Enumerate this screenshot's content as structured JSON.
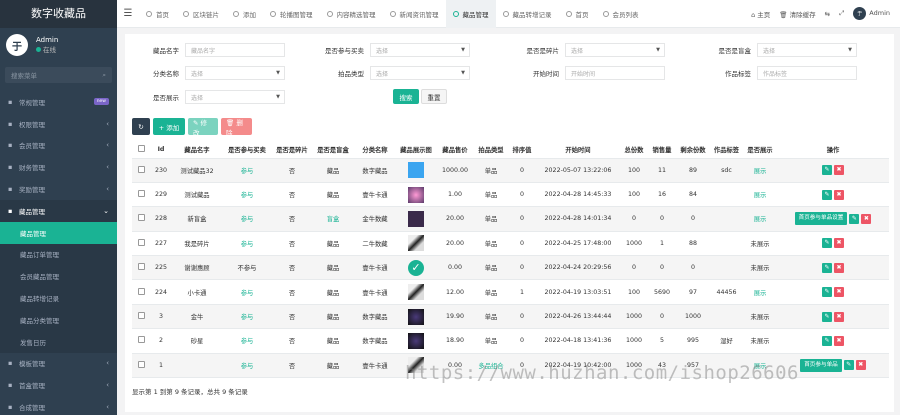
{
  "app": {
    "title": "数字收藏品"
  },
  "user": {
    "name": "Admin",
    "status": "在线",
    "avatar_text": "于哥"
  },
  "search": {
    "placeholder": "搜索菜单"
  },
  "sidebar": {
    "items": [
      {
        "label": "常规管理",
        "icon": "gear-icon",
        "badge": "new"
      },
      {
        "label": "权限管理",
        "icon": "lock-icon"
      },
      {
        "label": "会员管理",
        "icon": "user-icon"
      },
      {
        "label": "财务管理",
        "icon": "money-icon"
      },
      {
        "label": "奖励管理",
        "icon": "gift-icon"
      },
      {
        "label": "藏品管理",
        "icon": "box-icon",
        "open": true
      }
    ],
    "sub_items": [
      {
        "label": "藏品管理",
        "active": true
      },
      {
        "label": "藏品订单管理"
      },
      {
        "label": "会员藏品管理"
      },
      {
        "label": "藏品转增记录"
      },
      {
        "label": "藏品分类管理"
      },
      {
        "label": "发售日历"
      }
    ],
    "bottom_items": [
      {
        "label": "模板管理",
        "icon": "template-icon"
      },
      {
        "label": "首盒管理",
        "icon": "cube-icon"
      },
      {
        "label": "合成管理",
        "icon": "merge-icon"
      }
    ]
  },
  "topbar": {
    "tabs": [
      {
        "label": "首页"
      },
      {
        "label": "区块链片"
      },
      {
        "label": "添加"
      },
      {
        "label": "轮播图管理"
      },
      {
        "label": "内容精选管理"
      },
      {
        "label": "新闻资讯管理"
      },
      {
        "label": "藏品管理",
        "active": true
      },
      {
        "label": "藏品转增记录"
      },
      {
        "label": "首页"
      },
      {
        "label": "会员列表"
      }
    ],
    "right": {
      "home": "主页",
      "clear": "清除缓存",
      "admin": "Admin"
    }
  },
  "filters": {
    "rows": [
      [
        {
          "label": "藏品名字",
          "placeholder": "藏品名字",
          "type": "input"
        },
        {
          "label": "是否参与买卖",
          "placeholder": "选择",
          "type": "select"
        },
        {
          "label": "是否是碎片",
          "placeholder": "选择",
          "type": "select"
        },
        {
          "label": "是否是盲盒",
          "placeholder": "选择",
          "type": "select"
        }
      ],
      [
        {
          "label": "分类名称",
          "placeholder": "选择",
          "type": "select"
        },
        {
          "label": "拍品类型",
          "placeholder": "选择",
          "type": "select"
        },
        {
          "label": "开始时间",
          "placeholder": "开始时间",
          "type": "input"
        },
        {
          "label": "作品标签",
          "placeholder": "作品标签",
          "type": "input"
        }
      ],
      [
        {
          "label": "是否展示",
          "placeholder": "选择",
          "type": "select"
        }
      ]
    ],
    "search_label": "搜索",
    "reset_label": "重置"
  },
  "toolbar": {
    "add_label": "+ 添加",
    "edit_label": "✎ 修改",
    "delete_label": "🗑 删除"
  },
  "table": {
    "headers": [
      "",
      "Id",
      "藏品名字",
      "是否参与买卖",
      "是否是碎片",
      "是否是盲盒",
      "分类名称",
      "藏品展示图",
      "藏品售价",
      "拍品类型",
      "排序值",
      "开始时间",
      "总份数",
      "销售量",
      "剩余份数",
      "作品标签",
      "是否展示",
      "操作"
    ],
    "rows": [
      {
        "id": "230",
        "name": "测试藏品32",
        "trade": "参与",
        "frag": "否",
        "blind": "藏品",
        "cat": "数字藏品",
        "thumb": "blue",
        "price": "1000.00",
        "type": "单品",
        "sort": "0",
        "start": "2022-05-07 13:22:06",
        "total": "100",
        "sold": "11",
        "left": "89",
        "tag": "sdc",
        "show": "展示",
        "wide": ""
      },
      {
        "id": "229",
        "name": "测试藏品",
        "trade": "参与",
        "frag": "否",
        "blind": "藏品",
        "cat": "壹牛卡通",
        "thumb": "pink",
        "price": "1.00",
        "type": "单品",
        "sort": "0",
        "start": "2022-04-28 14:45:33",
        "total": "100",
        "sold": "16",
        "left": "84",
        "tag": "",
        "show": "展示",
        "wide": ""
      },
      {
        "id": "228",
        "name": "新盲盒",
        "trade": "参与",
        "frag": "否",
        "blind": "盲盒",
        "cat": "金牛数藏",
        "thumb": "dark",
        "price": "20.00",
        "type": "单品",
        "sort": "0",
        "start": "2022-04-28 14:01:34",
        "total": "0",
        "sold": "0",
        "left": "0",
        "tag": "",
        "show": "展示",
        "wide": "首页参与单品设置"
      },
      {
        "id": "227",
        "name": "我是碎片",
        "trade": "参与",
        "frag": "否",
        "blind": "藏品",
        "cat": "二牛数藏",
        "thumb": "bw",
        "price": "20.00",
        "type": "单品",
        "sort": "0",
        "start": "2022-04-25 17:48:00",
        "total": "1000",
        "sold": "1",
        "left": "88",
        "tag": "",
        "show": "未展示",
        "wide": ""
      },
      {
        "id": "225",
        "name": "谢谢惠顾",
        "trade": "不参与",
        "frag": "否",
        "blind": "藏品",
        "cat": "壹牛卡通",
        "thumb": "check",
        "price": "0.00",
        "type": "单品",
        "sort": "0",
        "start": "2022-04-24 20:29:56",
        "total": "0",
        "sold": "0",
        "left": "0",
        "tag": "",
        "show": "未展示",
        "wide": ""
      },
      {
        "id": "224",
        "name": "小卡通",
        "trade": "参与",
        "frag": "否",
        "blind": "藏品",
        "cat": "壹牛卡通",
        "thumb": "bw",
        "price": "12.00",
        "type": "单品",
        "sort": "1",
        "start": "2022-04-19 13:03:51",
        "total": "100",
        "sold": "5690",
        "left": "97",
        "tag": "44456",
        "show": "展示",
        "wide": ""
      },
      {
        "id": "3",
        "name": "金牛",
        "trade": "参与",
        "frag": "否",
        "blind": "藏品",
        "cat": "数字藏品",
        "thumb": "night",
        "price": "19.90",
        "type": "单品",
        "sort": "0",
        "start": "2022-04-26 13:44:44",
        "total": "1000",
        "sold": "0",
        "left": "1000",
        "tag": "",
        "show": "未展示",
        "wide": ""
      },
      {
        "id": "2",
        "name": "砂星",
        "trade": "参与",
        "frag": "否",
        "blind": "藏品",
        "cat": "数字藏品",
        "thumb": "night",
        "price": "18.90",
        "type": "单品",
        "sort": "0",
        "start": "2022-04-18 13:41:36",
        "total": "1000",
        "sold": "5",
        "left": "995",
        "tag": "湿好",
        "show": "未展示",
        "wide": ""
      },
      {
        "id": "1",
        "name": "",
        "trade": "参与",
        "frag": "否",
        "blind": "藏品",
        "cat": "壹牛卡通",
        "thumb": "bw",
        "price": "0.00",
        "type": "多品组合",
        "sort": "0",
        "start": "2022-04-19 10:42:00",
        "total": "1000",
        "sold": "43",
        "left": "957",
        "tag": "",
        "show": "展示",
        "wide": "首页参与单品"
      }
    ]
  },
  "footer": {
    "summary": "显示第 1 到第 9 条记录，总共 9 条记录"
  },
  "watermark": {
    "text": "https://www.huzhan.com/ishop26606"
  }
}
